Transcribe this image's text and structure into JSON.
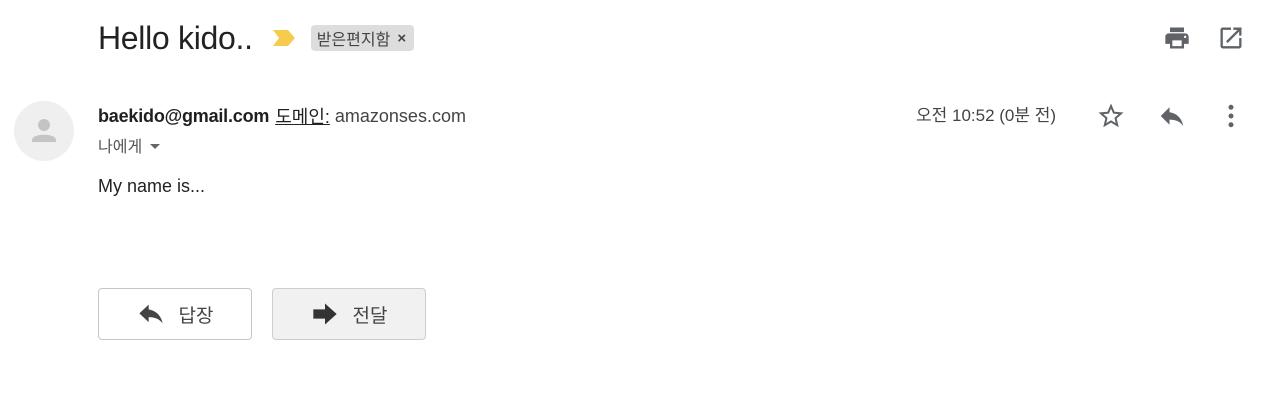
{
  "email": {
    "subject": "Hello kido..",
    "label_chip": "받은편지함",
    "label_remove": "×",
    "sender_email": "baekido@gmail.com",
    "domain_label": "도메인:",
    "domain_value": "amazonses.com",
    "timestamp": "오전 10:52 (0분 전)",
    "recipient": "나에게",
    "body": "My name is..."
  },
  "actions": {
    "reply_label": "답장",
    "forward_label": "전달"
  },
  "icons": {
    "importance": "importance-marker-icon",
    "print": "print-icon",
    "open_new_window": "open-in-new-window-icon",
    "star": "star-icon",
    "reply": "reply-icon",
    "more": "more-vert-icon",
    "avatar": "person-avatar-icon",
    "forward": "forward-arrow-icon"
  },
  "colors": {
    "importance_marker": "#F7CB4D",
    "chip_background": "#DDDDDD",
    "icon_gray": "#5F6368",
    "forward_button_background": "#F1F1F1"
  }
}
